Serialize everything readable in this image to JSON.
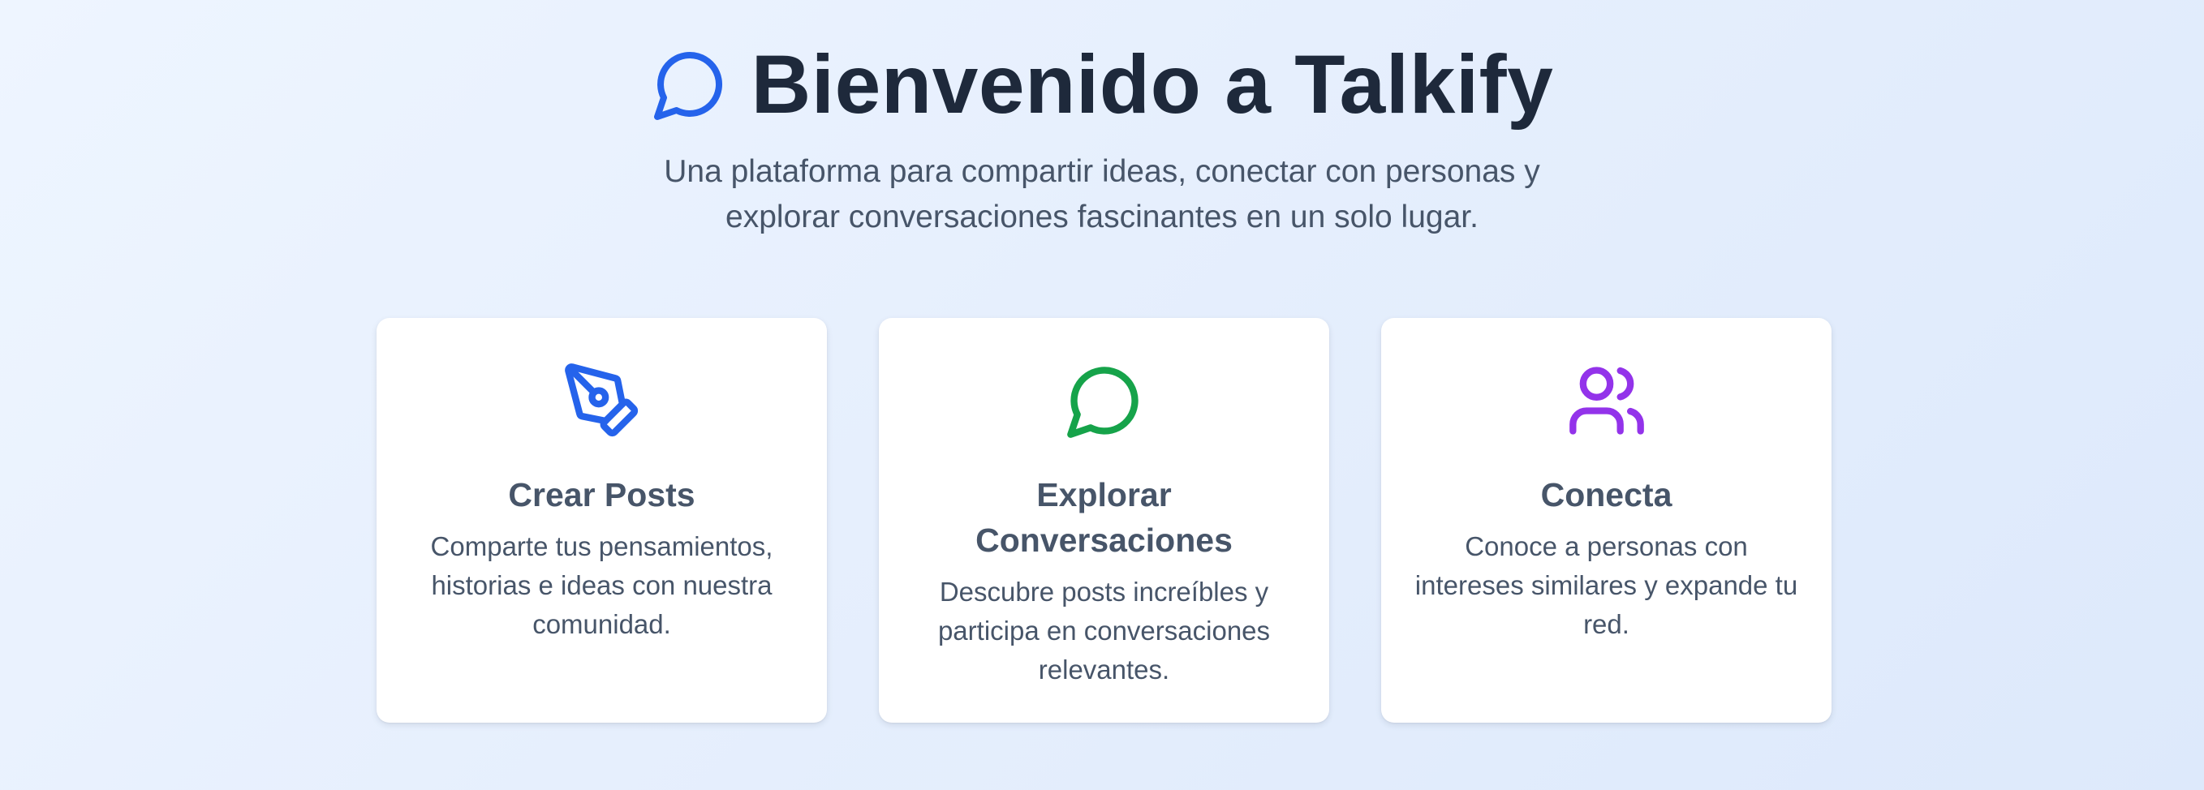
{
  "hero": {
    "title": "Bienvenido a Talkify",
    "title_icon": "chat-bubble-icon",
    "subtitle_line1": "Una plataforma para compartir ideas, conectar con personas y",
    "subtitle_line2": "explorar conversaciones fascinantes en un solo lugar."
  },
  "colors": {
    "title_icon": "#2563eb",
    "title_text": "#1e293b",
    "body_text": "#475569",
    "create_icon": "#2563eb",
    "explore_icon": "#16a34a",
    "connect_icon": "#9333ea"
  },
  "cards": [
    {
      "icon": "pen-tool-icon",
      "title": "Crear Posts",
      "description": "Comparte tus pensamientos, historias e ideas con nuestra comunidad."
    },
    {
      "icon": "message-circle-icon",
      "title": "Explorar Conversaciones",
      "description": "Descubre posts increíbles y participa en conversaciones relevantes."
    },
    {
      "icon": "users-icon",
      "title": "Conecta",
      "description": "Conoce a personas con intereses similares y expande tu red."
    }
  ]
}
